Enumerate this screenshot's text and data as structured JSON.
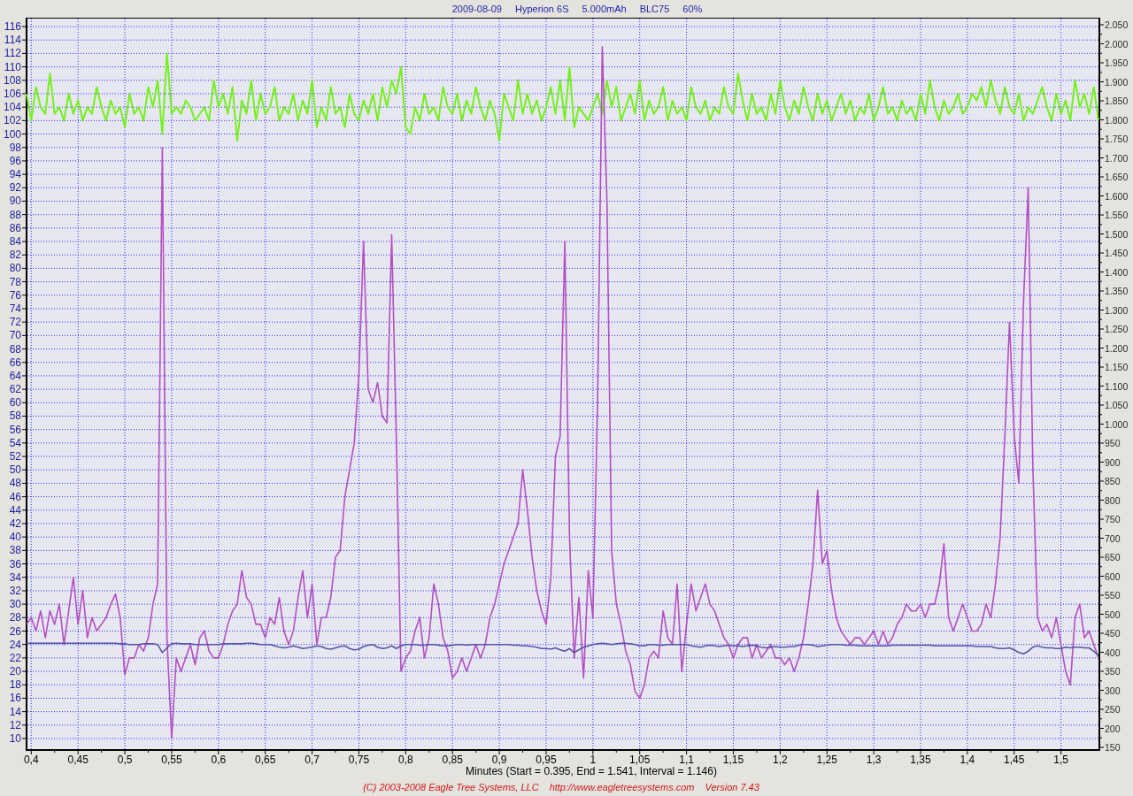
{
  "header": [
    "2009-08-09",
    "Hyperion 6S",
    "5.000mAh",
    "BLC75",
    "60%"
  ],
  "chart": {
    "chart_data": {
      "type": "line",
      "grid": true,
      "xlabel": "Minutes (Start = 0.395, End = 1.541, Interval = 1.146)",
      "x": [
        0.395,
        0.4,
        0.405,
        0.41,
        0.415,
        0.42,
        0.425,
        0.43,
        0.435,
        0.44,
        0.445,
        0.45,
        0.455,
        0.46,
        0.465,
        0.47,
        0.475,
        0.48,
        0.485,
        0.49,
        0.495,
        0.5,
        0.505,
        0.51,
        0.515,
        0.52,
        0.525,
        0.53,
        0.535,
        0.54,
        0.545,
        0.55,
        0.555,
        0.56,
        0.565,
        0.57,
        0.575,
        0.58,
        0.585,
        0.59,
        0.595,
        0.6,
        0.605,
        0.61,
        0.615,
        0.62,
        0.625,
        0.63,
        0.635,
        0.64,
        0.645,
        0.65,
        0.655,
        0.66,
        0.665,
        0.67,
        0.675,
        0.68,
        0.685,
        0.69,
        0.695,
        0.7,
        0.705,
        0.71,
        0.715,
        0.72,
        0.725,
        0.73,
        0.735,
        0.74,
        0.745,
        0.75,
        0.755,
        0.76,
        0.765,
        0.77,
        0.775,
        0.78,
        0.785,
        0.79,
        0.795,
        0.8,
        0.805,
        0.81,
        0.815,
        0.82,
        0.825,
        0.83,
        0.835,
        0.84,
        0.845,
        0.85,
        0.855,
        0.86,
        0.865,
        0.87,
        0.875,
        0.88,
        0.885,
        0.89,
        0.895,
        0.9,
        0.905,
        0.91,
        0.915,
        0.92,
        0.925,
        0.93,
        0.935,
        0.94,
        0.945,
        0.95,
        0.955,
        0.96,
        0.965,
        0.97,
        0.975,
        0.98,
        0.985,
        0.99,
        0.995,
        1,
        1.005,
        1.01,
        1.015,
        1.02,
        1.025,
        1.03,
        1.035,
        1.04,
        1.045,
        1.05,
        1.055,
        1.06,
        1.065,
        1.07,
        1.075,
        1.08,
        1.085,
        1.09,
        1.095,
        1.1,
        1.105,
        1.11,
        1.115,
        1.12,
        1.125,
        1.13,
        1.135,
        1.14,
        1.145,
        1.15,
        1.155,
        1.16,
        1.165,
        1.17,
        1.175,
        1.18,
        1.185,
        1.19,
        1.195,
        1.2,
        1.205,
        1.21,
        1.215,
        1.22,
        1.225,
        1.23,
        1.235,
        1.24,
        1.245,
        1.25,
        1.255,
        1.26,
        1.265,
        1.27,
        1.275,
        1.28,
        1.285,
        1.29,
        1.295,
        1.3,
        1.305,
        1.31,
        1.315,
        1.32,
        1.325,
        1.33,
        1.335,
        1.34,
        1.345,
        1.35,
        1.355,
        1.36,
        1.365,
        1.37,
        1.375,
        1.38,
        1.385,
        1.39,
        1.395,
        1.4,
        1.405,
        1.41,
        1.415,
        1.42,
        1.425,
        1.43,
        1.435,
        1.44,
        1.445,
        1.45,
        1.455,
        1.46,
        1.465,
        1.47,
        1.475,
        1.48,
        1.485,
        1.49,
        1.495,
        1.5,
        1.505,
        1.51,
        1.515,
        1.52,
        1.525,
        1.53,
        1.535,
        1.54
      ],
      "series": [
        {
          "color": "#74f01c",
          "values": [
            106,
            102,
            107,
            104,
            103,
            109,
            103,
            104,
            102,
            106,
            103,
            105,
            102,
            104,
            103,
            107,
            104,
            102,
            105,
            103,
            104,
            101,
            106,
            103,
            104,
            102,
            107,
            104,
            108,
            100,
            112,
            103,
            104,
            103,
            105,
            104,
            102,
            103,
            104,
            102,
            108,
            104,
            106,
            103,
            107,
            99,
            105,
            103,
            108,
            102,
            106,
            103,
            104,
            107,
            102,
            104,
            103,
            106,
            102,
            105,
            103,
            108,
            101,
            104,
            102,
            107,
            103,
            104,
            101,
            106,
            103,
            102,
            105,
            103,
            106,
            102,
            107,
            104,
            108,
            106,
            110,
            101,
            100,
            104,
            102,
            106,
            103,
            104,
            102,
            107,
            104,
            103,
            106,
            102,
            105,
            103,
            107,
            104,
            102,
            105,
            103,
            99,
            106,
            104,
            102,
            108,
            103,
            106,
            103,
            105,
            102,
            104,
            107,
            103,
            108,
            102,
            110,
            101,
            104,
            103,
            102,
            104,
            106,
            103,
            108,
            104,
            107,
            102,
            104,
            106,
            103,
            108,
            102,
            105,
            103,
            104,
            107,
            102,
            105,
            103,
            104,
            102,
            107,
            104,
            103,
            105,
            102,
            104,
            103,
            107,
            104,
            103,
            109,
            105,
            102,
            106,
            103,
            104,
            102,
            106,
            103,
            108,
            104,
            102,
            105,
            103,
            107,
            104,
            102,
            106,
            103,
            105,
            102,
            104,
            106,
            103,
            105,
            102,
            104,
            103,
            106,
            102,
            104,
            107,
            103,
            104,
            102,
            105,
            103,
            104,
            102,
            106,
            103,
            108,
            104,
            102,
            105,
            103,
            104,
            106,
            103,
            104,
            106,
            105,
            107,
            104,
            108,
            105,
            103,
            107,
            104,
            103,
            106,
            102,
            104,
            103,
            105,
            107,
            104,
            102,
            106,
            103,
            105,
            102,
            108,
            104,
            106,
            103,
            107,
            102
          ]
        },
        {
          "color": "#b34fc0",
          "values": [
            27,
            28,
            26,
            29,
            25,
            29,
            27,
            30,
            24,
            29,
            34,
            27,
            32,
            25,
            28,
            26,
            27,
            28,
            30,
            31.5,
            28,
            19.5,
            22,
            22,
            24,
            23,
            25,
            30,
            33,
            98,
            25,
            10,
            22,
            20,
            22,
            24,
            21,
            25,
            26,
            23,
            22,
            22,
            24,
            27,
            29,
            30,
            35,
            31,
            30,
            27,
            27,
            25,
            28,
            27,
            31,
            26,
            24,
            26,
            31,
            35,
            28,
            33,
            24,
            28,
            28,
            31,
            37,
            38,
            46,
            50,
            54,
            64,
            84,
            62,
            60,
            63,
            58,
            57,
            85,
            55,
            20,
            22,
            23,
            26,
            28,
            22,
            25,
            33,
            30,
            25,
            23,
            19,
            20,
            22,
            20,
            22,
            24,
            22,
            24,
            28,
            30,
            33,
            36,
            38,
            40,
            42,
            50,
            44,
            37,
            32,
            29,
            27,
            34,
            52,
            55,
            84,
            40,
            22,
            31,
            19,
            35,
            28,
            60,
            113,
            90,
            38,
            30,
            27,
            23,
            21,
            17,
            16,
            18,
            22,
            23,
            22,
            29,
            25,
            24,
            33,
            20,
            27,
            33,
            29,
            31,
            33,
            30,
            29,
            27,
            25,
            24,
            22,
            24,
            25,
            25,
            22,
            24,
            22,
            23,
            24,
            22,
            22,
            21,
            22,
            20,
            22,
            25,
            30,
            36,
            47,
            36,
            38,
            32,
            28,
            26,
            25,
            24,
            25,
            25,
            24,
            25,
            26,
            24,
            26,
            24,
            25,
            27,
            28,
            30,
            29,
            29,
            30,
            28,
            30,
            30,
            33,
            39,
            28,
            26,
            28,
            30,
            28,
            26,
            26,
            27,
            30,
            28,
            33,
            40,
            55,
            72,
            55,
            48,
            75,
            92,
            50,
            28,
            26,
            27,
            25,
            28,
            24,
            20,
            18,
            28,
            30,
            25,
            26,
            24,
            22
          ]
        },
        {
          "color": "#5555a8",
          "values": [
            24.2,
            24.2,
            24.2,
            24.2,
            24.2,
            24.2,
            24.2,
            24.2,
            24.2,
            24.2,
            24.2,
            24.2,
            24.2,
            24.2,
            24.2,
            24.2,
            24.2,
            24.2,
            24.2,
            24.2,
            24.1,
            24.1,
            24.0,
            24.0,
            24.0,
            24.1,
            24.1,
            24.1,
            24.0,
            22.8,
            23.5,
            24.1,
            24.2,
            24.1,
            24.1,
            24.1,
            24.0,
            24.0,
            24.0,
            24.0,
            24.0,
            24.0,
            24.1,
            24.1,
            24.1,
            24.1,
            24.1,
            24.2,
            24.2,
            24.1,
            24.0,
            24.0,
            24.0,
            23.8,
            23.6,
            23.5,
            23.6,
            23.8,
            23.6,
            23.4,
            23.5,
            23.6,
            23.8,
            23.7,
            23.4,
            23.3,
            23.5,
            23.7,
            23.8,
            23.4,
            23.2,
            23.3,
            23.7,
            23.9,
            24.0,
            23.6,
            23.4,
            23.5,
            23.8,
            23.4,
            23.8,
            24.0,
            24.0,
            24.0,
            23.9,
            23.9,
            24.0,
            24.0,
            23.9,
            23.8,
            23.8,
            23.9,
            24.0,
            24.0,
            23.9,
            24.0,
            24.0,
            24.0,
            24.0,
            24.0,
            24.0,
            24.0,
            24.0,
            24.0,
            23.9,
            23.9,
            23.8,
            23.8,
            23.7,
            23.6,
            23.4,
            23.4,
            23.3,
            23.5,
            23.2,
            23.0,
            23.4,
            22.8,
            23.2,
            23.6,
            23.8,
            24.0,
            24.1,
            24.2,
            24.1,
            24.0,
            24.1,
            24.2,
            24.2,
            24.1,
            24.0,
            23.8,
            23.8,
            24.0,
            24.0,
            23.9,
            23.9,
            24.0,
            24.0,
            24.0,
            24.0,
            24.0,
            23.8,
            23.7,
            23.6,
            23.8,
            23.9,
            23.8,
            23.7,
            23.8,
            23.9,
            23.8,
            23.8,
            23.7,
            23.8,
            23.9,
            23.8,
            23.6,
            23.5,
            23.6,
            23.7,
            23.6,
            23.6,
            23.7,
            23.7,
            23.9,
            24.0,
            24.0,
            23.9,
            23.7,
            23.8,
            23.9,
            24.0,
            24.0,
            24.0,
            23.9,
            23.9,
            23.9,
            23.8,
            23.8,
            23.8,
            23.8,
            23.8,
            23.8,
            23.8,
            23.9,
            23.9,
            23.9,
            23.9,
            23.9,
            23.9,
            23.9,
            23.9,
            23.9,
            23.8,
            23.8,
            23.8,
            23.8,
            23.8,
            23.8,
            23.8,
            23.8,
            23.8,
            23.7,
            23.7,
            23.7,
            23.7,
            23.5,
            23.4,
            23.4,
            23.5,
            23.2,
            22.8,
            22.6,
            23.0,
            23.6,
            23.8,
            23.6,
            23.5,
            23.5,
            23.4,
            23.4,
            23.6,
            23.5,
            23.6,
            23.6,
            23.5,
            23.5,
            23.0,
            22.4
          ]
        }
      ],
      "xlim": [
        0.395,
        1.541
      ],
      "ylim": [
        8.29,
        117.32
      ],
      "xticks": [
        {
          "value": 0.4,
          "label": "0,4"
        },
        {
          "value": 0.45,
          "label": "0,45"
        },
        {
          "value": 0.5,
          "label": "0,5"
        },
        {
          "value": 0.55,
          "label": "0,55"
        },
        {
          "value": 0.6,
          "label": "0,6"
        },
        {
          "value": 0.65,
          "label": "0,65"
        },
        {
          "value": 0.7,
          "label": "0,7"
        },
        {
          "value": 0.75,
          "label": "0,75"
        },
        {
          "value": 0.8,
          "label": "0,8"
        },
        {
          "value": 0.85,
          "label": "0,85"
        },
        {
          "value": 0.9,
          "label": "0,9"
        },
        {
          "value": 0.95,
          "label": "0,95"
        },
        {
          "value": 1,
          "label": "1"
        },
        {
          "value": 1.05,
          "label": "1,05"
        },
        {
          "value": 1.1,
          "label": "1,1"
        },
        {
          "value": 1.15,
          "label": "1,15"
        },
        {
          "value": 1.2,
          "label": "1,2"
        },
        {
          "value": 1.25,
          "label": "1,25"
        },
        {
          "value": 1.3,
          "label": "1,3"
        },
        {
          "value": 1.35,
          "label": "1,35"
        },
        {
          "value": 1.4,
          "label": "1,4"
        },
        {
          "value": 1.45,
          "label": "1,45"
        },
        {
          "value": 1.5,
          "label": "1,5"
        }
      ],
      "yticks": [
        10,
        12,
        14,
        16,
        18,
        20,
        22,
        24,
        26,
        28,
        30,
        32,
        34,
        36,
        38,
        40,
        42,
        44,
        46,
        48,
        50,
        52,
        54,
        56,
        58,
        60,
        62,
        64,
        66,
        68,
        70,
        72,
        74,
        76,
        78,
        80,
        82,
        84,
        86,
        88,
        90,
        92,
        94,
        96,
        98,
        100,
        102,
        104,
        106,
        108,
        110,
        112,
        114,
        116
      ]
    },
    "right_axis_ticks": [
      "2.050",
      "2.000",
      "1.950",
      "1.900",
      "1.850",
      "1.800",
      "1.750",
      "1.700",
      "1.650",
      "1.600",
      "1.550",
      "1.500",
      "1.450",
      "1.400",
      "1.350",
      "1.300",
      "1.250",
      "1.200",
      "1.150",
      "1.100",
      "1.050",
      "1.000",
      "950",
      "900",
      "850",
      "800",
      "750",
      "700",
      "650",
      "600",
      "550",
      "500",
      "450",
      "400",
      "350",
      "300",
      "250",
      "200",
      "150"
    ]
  },
  "footer": [
    "(C) 2003-2008 Eagle Tree Systems, LLC",
    "http://www.eagletreesystems.com",
    "Version 7.43"
  ]
}
